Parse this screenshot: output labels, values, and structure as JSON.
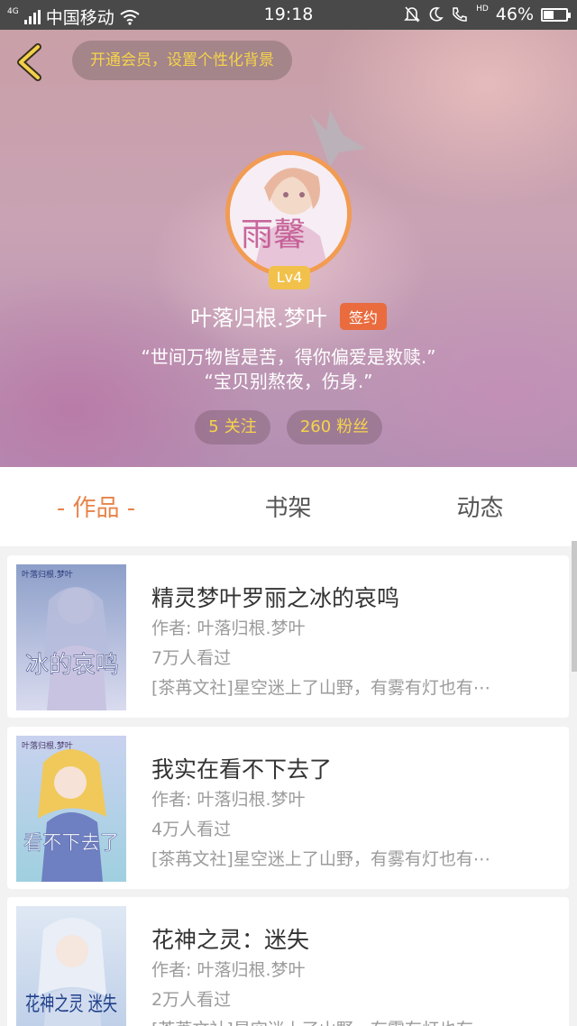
{
  "status_bar": {
    "network": "4G",
    "carrier": "中国移动",
    "time": "19:18",
    "hd": "HD",
    "battery": "46%",
    "battery_level": 0.46
  },
  "header": {
    "vip_prompt": "开通会员，设置个性化背景",
    "avatar_text": "雨馨",
    "level": "Lv4",
    "username": "叶落归根.梦叶",
    "sign_badge": "签约",
    "bio_line1": "“世间万物皆是苦，得你偏爱是救赎.”",
    "bio_line2": "“宝贝别熬夜，伤身.”",
    "following_count": "5",
    "following_label": "关注",
    "followers_count": "260",
    "followers_label": "粉丝"
  },
  "tabs": [
    {
      "label": "- 作品 -",
      "active": true
    },
    {
      "label": "书架",
      "active": false
    },
    {
      "label": "动态",
      "active": false
    }
  ],
  "works": [
    {
      "title": "精灵梦叶罗丽之冰的哀鸣",
      "author": "作者: 叶落归根.梦叶",
      "views": "7万人看过",
      "desc": "[茶苒文社]星空迷上了山野，有雾有灯也有⋯",
      "cover_text": "冰的哀鸣",
      "cover_small": "叶落归根.梦叶"
    },
    {
      "title": "我实在看不下去了",
      "author": "作者: 叶落归根.梦叶",
      "views": "4万人看过",
      "desc": "[茶苒文社]星空迷上了山野，有雾有灯也有⋯",
      "cover_text": "看不下去了",
      "cover_small": "叶落归根.梦叶"
    },
    {
      "title": "花神之灵：迷失",
      "author": "作者: 叶落归根.梦叶",
      "views": "2万人看过",
      "desc": "[茶苒文社]星空迷上了山野，有雾有灯也有⋯",
      "cover_text": "花神之灵 迷失",
      "cover_small": ""
    }
  ],
  "colors": {
    "accent": "#e8834a",
    "gold": "#f6d44a",
    "sign_badge": "#e96b3e"
  }
}
